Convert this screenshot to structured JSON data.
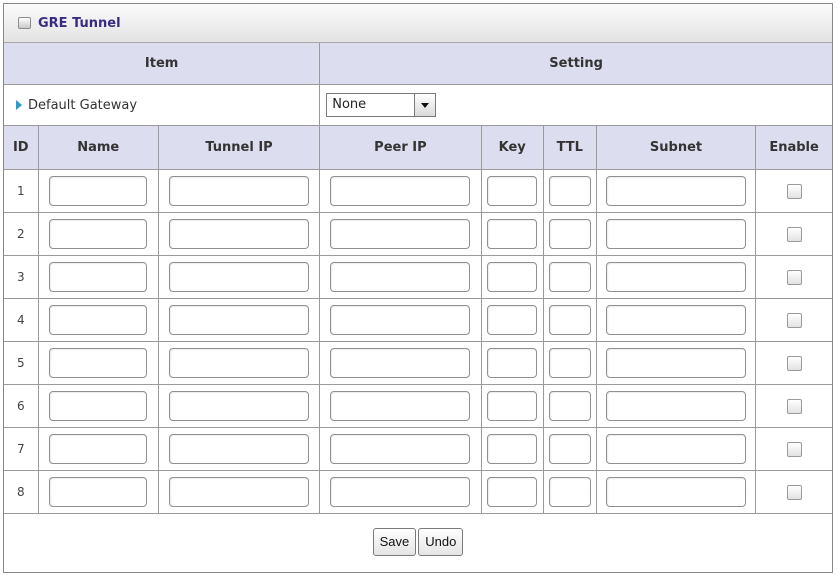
{
  "panel": {
    "title": "GRE Tunnel",
    "icon": "window-icon"
  },
  "header": {
    "item": "Item",
    "setting": "Setting"
  },
  "default_gateway": {
    "label": "Default Gateway",
    "selected": "None"
  },
  "columns": {
    "id": "ID",
    "name": "Name",
    "tunnel_ip": "Tunnel IP",
    "peer_ip": "Peer IP",
    "key": "Key",
    "ttl": "TTL",
    "subnet": "Subnet",
    "enable": "Enable"
  },
  "rows": [
    {
      "id": "1",
      "name": "",
      "tunnel_ip": "",
      "peer_ip": "",
      "key": "",
      "ttl": "",
      "subnet": "",
      "enabled": false
    },
    {
      "id": "2",
      "name": "",
      "tunnel_ip": "",
      "peer_ip": "",
      "key": "",
      "ttl": "",
      "subnet": "",
      "enabled": false
    },
    {
      "id": "3",
      "name": "",
      "tunnel_ip": "",
      "peer_ip": "",
      "key": "",
      "ttl": "",
      "subnet": "",
      "enabled": false
    },
    {
      "id": "4",
      "name": "",
      "tunnel_ip": "",
      "peer_ip": "",
      "key": "",
      "ttl": "",
      "subnet": "",
      "enabled": false
    },
    {
      "id": "5",
      "name": "",
      "tunnel_ip": "",
      "peer_ip": "",
      "key": "",
      "ttl": "",
      "subnet": "",
      "enabled": false
    },
    {
      "id": "6",
      "name": "",
      "tunnel_ip": "",
      "peer_ip": "",
      "key": "",
      "ttl": "",
      "subnet": "",
      "enabled": false
    },
    {
      "id": "7",
      "name": "",
      "tunnel_ip": "",
      "peer_ip": "",
      "key": "",
      "ttl": "",
      "subnet": "",
      "enabled": false
    },
    {
      "id": "8",
      "name": "",
      "tunnel_ip": "",
      "peer_ip": "",
      "key": "",
      "ttl": "",
      "subnet": "",
      "enabled": false
    }
  ],
  "buttons": {
    "save": "Save",
    "undo": "Undo"
  },
  "colors": {
    "header_bg": "#ddddf0",
    "title_text": "#3a2a80",
    "bullet": "#2a9cc8"
  }
}
